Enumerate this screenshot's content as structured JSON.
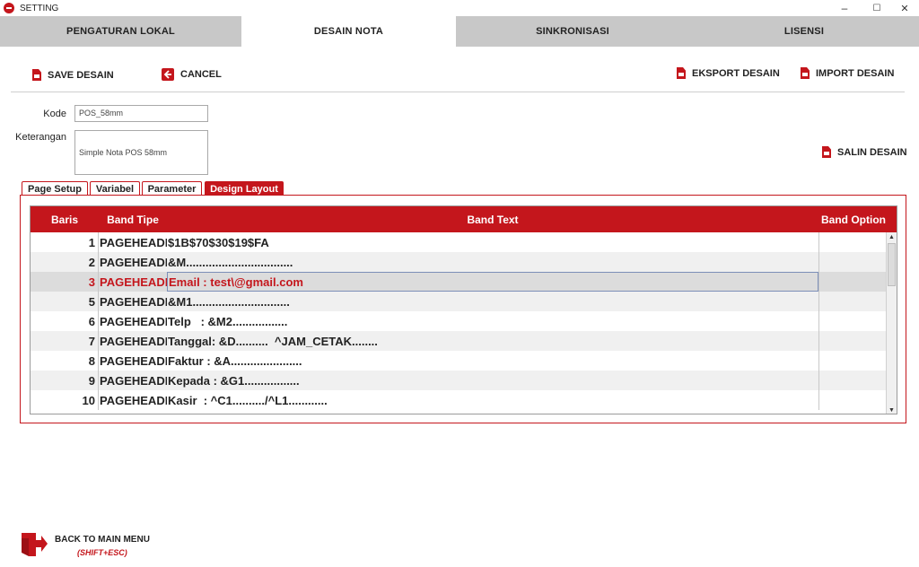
{
  "window": {
    "title": "SETTING",
    "controls": {
      "minimize": "–",
      "maximize": "☐",
      "close": "✕"
    }
  },
  "main_tabs": [
    {
      "label": "PENGATURAN LOKAL",
      "active": false
    },
    {
      "label": "DESAIN NOTA",
      "active": true
    },
    {
      "label": "SINKRONISASI",
      "active": false
    },
    {
      "label": "LISENSI",
      "active": false
    }
  ],
  "toolbar": {
    "save_label": "SAVE DESAIN",
    "cancel_label": "CANCEL",
    "export_label": "EKSPORT DESAIN",
    "import_label": "IMPORT DESAIN",
    "salin_label": "SALIN DESAIN"
  },
  "form": {
    "kode_label": "Kode",
    "kode_value": "POS_58mm",
    "keterangan_label": "Keterangan",
    "keterangan_value": "Simple Nota POS 58mm"
  },
  "sub_tabs": [
    {
      "label": "Page Setup",
      "active": false
    },
    {
      "label": "Variabel",
      "active": false
    },
    {
      "label": "Parameter",
      "active": false
    },
    {
      "label": "Design Layout",
      "active": true
    }
  ],
  "table": {
    "headers": [
      "Baris",
      "Band Tipe",
      "Band Text",
      "Band Option"
    ],
    "rows": [
      {
        "no": "1",
        "tipe": "PAGEHEADER",
        "text": "$1B$70$30$19$FA",
        "option": ""
      },
      {
        "no": "2",
        "tipe": "PAGEHEADER",
        "text": "&M.................................",
        "option": ""
      },
      {
        "no": "3",
        "tipe": "PAGEHEADER",
        "text": "Email : test\\@gmail.com",
        "option": "",
        "selected": true
      },
      {
        "no": "5",
        "tipe": "PAGEHEADER",
        "text": "&M1..............................",
        "option": ""
      },
      {
        "no": "6",
        "tipe": "PAGEHEADER",
        "text": "Telp   : &M2.................",
        "option": ""
      },
      {
        "no": "7",
        "tipe": "PAGEHEADER",
        "text": "Tanggal: &D..........  ^JAM_CETAK........",
        "option": ""
      },
      {
        "no": "8",
        "tipe": "PAGEHEADER",
        "text": "Faktur : &A......................",
        "option": ""
      },
      {
        "no": "9",
        "tipe": "PAGEHEADER",
        "text": "Kepada : &G1.................",
        "option": ""
      },
      {
        "no": "10",
        "tipe": "PAGEHEADER",
        "text": "Kasir  : ^C1........../^L1............",
        "option": ""
      }
    ]
  },
  "footer": {
    "back_label": "BACK TO MAIN MENU",
    "back_shortcut": "(SHIFT+ESC)"
  },
  "colors": {
    "accent": "#c4161c",
    "tab_inactive": "#c8c8c8",
    "row_alt": "#f0f0f0",
    "row_selected": "#dcdcdc"
  }
}
